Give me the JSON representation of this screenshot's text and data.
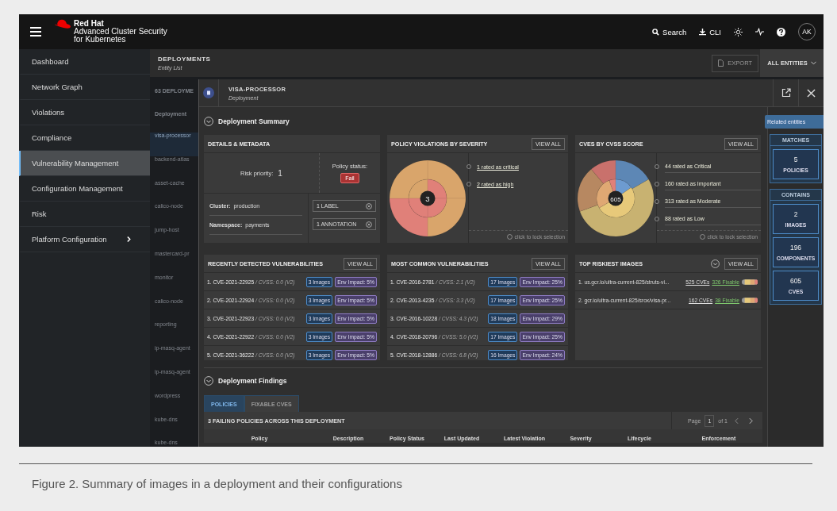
{
  "header": {
    "brand": "Red Hat",
    "product": "Advanced Cluster Security",
    "product_sub": "for Kubernetes",
    "search": "Search",
    "cli": "CLI",
    "avatar": "AK"
  },
  "sidebar": {
    "items": [
      {
        "label": "Dashboard",
        "selected": false,
        "has_submenu": false
      },
      {
        "label": "Network Graph",
        "selected": false,
        "has_submenu": false
      },
      {
        "label": "Violations",
        "selected": false,
        "has_submenu": false
      },
      {
        "label": "Compliance",
        "selected": false,
        "has_submenu": false
      },
      {
        "label": "Vulnerability Management",
        "selected": true,
        "has_submenu": false
      },
      {
        "label": "Configuration Management",
        "selected": false,
        "has_submenu": false
      },
      {
        "label": "Risk",
        "selected": false,
        "has_submenu": false
      },
      {
        "label": "Platform Configuration",
        "selected": false,
        "has_submenu": true
      }
    ]
  },
  "entity_bar": {
    "title": "DEPLOYMENTS",
    "subtitle": "Entity List",
    "export": "EXPORT",
    "scope": "ALL ENTITIES"
  },
  "entity_list": {
    "count": "63 DEPLOYME",
    "column": "Deployment",
    "rows": [
      {
        "name": "visa-processor",
        "selected": true
      },
      {
        "name": "backend-atlas",
        "selected": false
      },
      {
        "name": "asset-cache",
        "selected": false
      },
      {
        "name": "calico-node",
        "selected": false
      },
      {
        "name": "jump-host",
        "selected": false
      },
      {
        "name": "mastercard-pr",
        "selected": false
      },
      {
        "name": "monitor",
        "selected": false
      },
      {
        "name": "calico-node",
        "selected": false
      },
      {
        "name": "reporting",
        "selected": false
      },
      {
        "name": "ip-masq-agent",
        "selected": false
      },
      {
        "name": "ip-masq-agent",
        "selected": false
      },
      {
        "name": "wordpress",
        "selected": false
      },
      {
        "name": "kube-dns",
        "selected": false
      },
      {
        "name": "kube-dns",
        "selected": false
      }
    ]
  },
  "panel": {
    "title": "VISA-PROCESSOR",
    "subtitle": "Deployment"
  },
  "summary": {
    "heading": "Deployment Summary",
    "details": {
      "title": "DETAILS & METADATA",
      "risk_label": "Risk priority:",
      "risk_value": "1",
      "policy_label": "Policy status:",
      "policy_value": "Fail",
      "cluster_label": "Cluster:",
      "cluster": "production",
      "namespace_label": "Namespace:",
      "namespace": "payments",
      "tags": [
        "1 LABEL",
        "1 ANNOTATION"
      ]
    },
    "violations": {
      "title": "POLICY VIOLATIONS BY SEVERITY",
      "view_all": "VIEW ALL",
      "center": "3",
      "legend": [
        "1 rated as critical",
        "2 rated as high"
      ],
      "hint": "click to lock selection"
    },
    "cves": {
      "title": "CVES BY CVSS SCORE",
      "view_all": "VIEW ALL",
      "center": "605",
      "legend": [
        "44 rated as Critical",
        "160 rated as Important",
        "313 rated as Moderate",
        "88 rated as Low"
      ],
      "hint": "click to lock selection"
    }
  },
  "recent": {
    "title": "RECENTLY DETECTED VULNERABILITIES",
    "view_all": "VIEW ALL",
    "rows": [
      {
        "cve": "1. CVE-2021-22925",
        "cvss": "/ CVSS: 0.0 (V2)",
        "images": "3 Images",
        "impact": "Env Impact: 5%"
      },
      {
        "cve": "2. CVE-2021-22924",
        "cvss": "/ CVSS: 0.0 (V2)",
        "images": "3 Images",
        "impact": "Env Impact: 5%"
      },
      {
        "cve": "3. CVE-2021-22923",
        "cvss": "/ CVSS: 0.0 (V2)",
        "images": "3 Images",
        "impact": "Env Impact: 5%"
      },
      {
        "cve": "4. CVE-2021-22922",
        "cvss": "/ CVSS: 0.0 (V2)",
        "images": "3 Images",
        "impact": "Env Impact: 5%"
      },
      {
        "cve": "5. CVE-2021-36222",
        "cvss": "/ CVSS: 0.0 (V2)",
        "images": "3 Images",
        "impact": "Env Impact: 5%"
      }
    ]
  },
  "common": {
    "title": "MOST COMMON VULNERABILITIES",
    "view_all": "VIEW ALL",
    "rows": [
      {
        "cve": "1. CVE-2016-2781",
        "cvss": "/ CVSS: 2.1 (V2)",
        "images": "17 Images",
        "impact": "Env Impact: 25%"
      },
      {
        "cve": "2. CVE-2013-4235",
        "cvss": "/ CVSS: 3.3 (V2)",
        "images": "17 Images",
        "impact": "Env Impact: 25%"
      },
      {
        "cve": "3. CVE-2016-10228",
        "cvss": "/ CVSS: 4.3 (V2)",
        "images": "18 Images",
        "impact": "Env Impact: 29%"
      },
      {
        "cve": "4. CVE-2018-20796",
        "cvss": "/ CVSS: 5.0 (V2)",
        "images": "17 Images",
        "impact": "Env Impact: 25%"
      },
      {
        "cve": "5. CVE-2018-12886",
        "cvss": "/ CVSS: 6.8 (V2)",
        "images": "16 Images",
        "impact": "Env Impact: 24%"
      }
    ]
  },
  "riskiest": {
    "title": "TOP RISKIEST IMAGES",
    "view_all": "VIEW ALL",
    "rows": [
      {
        "name": "1. us.gcr.io/ultra-current-825/struts-vi...",
        "cves": "525 CVEs",
        "fixable": "326 Fixable"
      },
      {
        "name": "2. gcr.io/ultra-current-825/srox/visa-pr...",
        "cves": "162 CVEs",
        "fixable": "38 Fixable"
      }
    ]
  },
  "related": {
    "tab": "Related entities",
    "groups": [
      {
        "heading": "MATCHES",
        "tiles": [
          {
            "value": "5",
            "label": "POLICIES"
          }
        ]
      },
      {
        "heading": "CONTAINS",
        "tiles": [
          {
            "value": "2",
            "label": "IMAGES"
          },
          {
            "value": "196",
            "label": "COMPONENTS"
          },
          {
            "value": "605",
            "label": "CVES"
          }
        ]
      }
    ]
  },
  "findings": {
    "heading": "Deployment Findings",
    "tabs": [
      {
        "label": "POLICIES",
        "selected": true
      },
      {
        "label": "FIXABLE CVES",
        "selected": false
      }
    ],
    "table_title": "3 FAILING POLICIES ACROSS THIS DEPLOYMENT",
    "page_label": "Page",
    "page": "1",
    "page_of": "of 1",
    "columns": [
      "Policy",
      "Description",
      "Policy Status",
      "Last Updated",
      "Latest Violation",
      "Severity",
      "Lifecycle",
      "Enforcement"
    ]
  },
  "caption": "Figure 2. Summary of images in a deployment and their configurations"
}
